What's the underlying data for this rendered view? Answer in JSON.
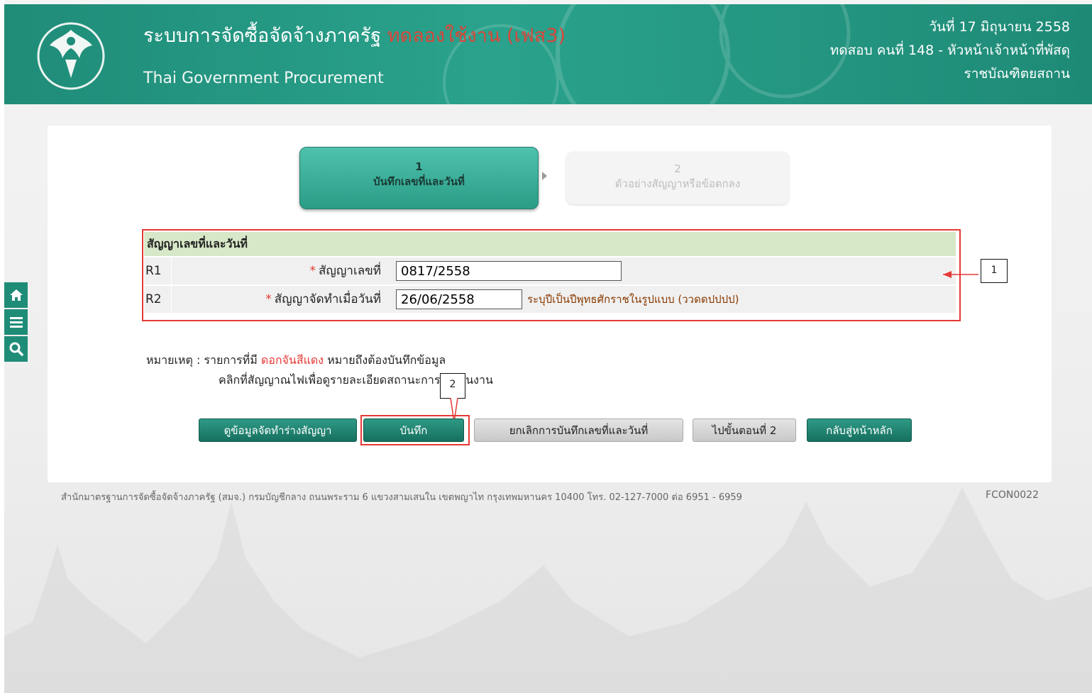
{
  "header": {
    "title": "ระบบการจัดซื้อจัดจ้างภาครัฐ",
    "title_trial": "ทดลองใช้งาน (เฟส3)",
    "subtitle": "Thai Government Procurement",
    "date": "วันที่ 17 มิถุนายน 2558",
    "user": "ทดสอบ คนที่ 148 - หัวหน้าเจ้าหน้าที่พัสดุ",
    "org": "ราชบัณฑิตยสถาน"
  },
  "side_toolbar": {
    "icons": [
      "home-icon",
      "menu-icon",
      "search-icon"
    ]
  },
  "steps": [
    {
      "number": "1",
      "label": "บันทึกเลขที่และวันที่"
    },
    {
      "number": "2",
      "label": "ตัวอย่างสัญญาหรือข้อตกลง"
    }
  ],
  "form": {
    "header": "สัญญาเลขที่และวันที่",
    "rows": [
      {
        "id": "R1",
        "required": "*",
        "label": "สัญญาเลขที่",
        "value": "0817/2558",
        "hint": ""
      },
      {
        "id": "R2",
        "required": "*",
        "label": "สัญญาจัดทำเมื่อวันที่",
        "value": "26/06/2558",
        "hint": "ระบุปีเป็นปีพุทธศักราชในรูปแบบ (ววดดปปปป)"
      }
    ]
  },
  "notes": {
    "prefix": "หมายเหตุ : รายการที่มี",
    "flower": "ดอกจันสีแดง",
    "suffix": "หมายถึงต้องบันทึกข้อมูล",
    "line2": "คลิกที่สัญญาณไฟเพื่อดูรายละเอียดสถานะการดำเนินงาน"
  },
  "buttons": {
    "view_draft": "ดูข้อมูลจัดทำร่างสัญญา",
    "save": "บันทึก",
    "cancel_record": "ยกเลิกการบันทึกเลขที่และวันที่",
    "go_step2": "ไปขั้นตอนที่ 2",
    "back_home": "กลับสู่หน้าหลัก"
  },
  "annotations": [
    {
      "number": "1"
    },
    {
      "number": "2"
    }
  ],
  "footer": {
    "text": "สำนักมาตรฐานการจัดซื้อจัดจ้างภาครัฐ (สมจ.) กรมบัญชีกลาง ถนนพระราม 6 แขวงสามเสนใน เขตพญาไท กรุงเทพมหานคร 10400 โทร. 02-127-7000 ต่อ 6951 - 6959",
    "code": "FCON0022"
  },
  "colors": {
    "header_green": "#1f8c78",
    "required_red": "#e03a2e",
    "annotation_red": "#e53935",
    "form_header_bg": "#d7e8c8"
  }
}
